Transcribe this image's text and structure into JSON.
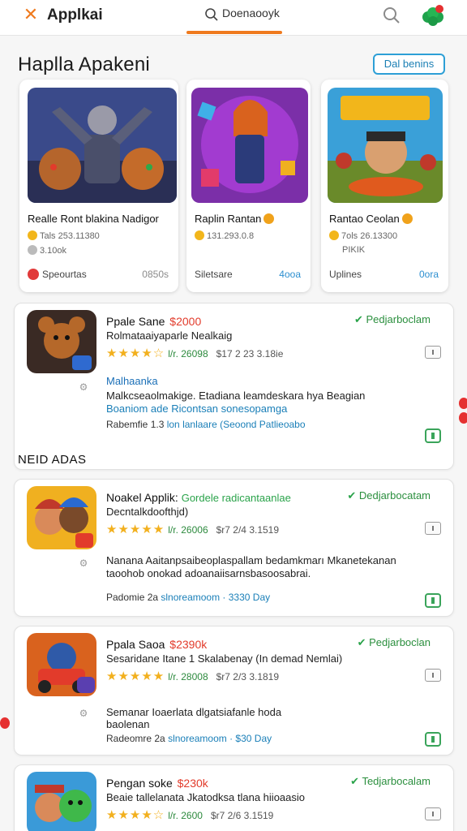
{
  "app": {
    "name": "Applkai",
    "search_value": "Doenaooyk",
    "accent": "#ef7a1e"
  },
  "section": {
    "title": "Haplla Apakeni",
    "button": "Dal benins"
  },
  "featured": [
    {
      "title": "Realle Ront blakina Nadigor",
      "meta1": "Tals 253.11380",
      "meta2": "3.10ok",
      "foot_left": "Speourtas",
      "foot_right": "0850s",
      "foot_right_color": "#8b8b8b"
    },
    {
      "title": "Raplin Rantan",
      "meta1": "131.293.0.8",
      "meta2": "",
      "foot_left": "Siletsare",
      "foot_right": "4ooa",
      "foot_right_color": "#2d8fd0"
    },
    {
      "title": "Rantao Ceolan",
      "meta1": "7ols 26.13300",
      "meta2": "PIKIK",
      "foot_left": "Uplines",
      "foot_right": "0ora",
      "foot_right_color": "#2d8fd0"
    }
  ],
  "section2": "NEID ADAS",
  "cards": [
    {
      "title": "Ppale Sane",
      "price": "$2000",
      "tag": "",
      "status": "Pedjarboclam",
      "subtitle": "Rolmataaiyaparle Nealkaig",
      "rating": "★★★★☆",
      "version": "l/r. 26098",
      "size": "$17 2 23 3.18ie",
      "category": "Malhaanka",
      "desc1": "Malkcseaolmakige. Etadiana leamdeskara hya Beagian",
      "desc2": "Boaniom ade Ricontsan sonesopamga",
      "foot_a": "Rabemfie 1.3",
      "foot_b": "lon lanlaare (Seoond Patlieoabo"
    },
    {
      "title": "Noakel Applik:",
      "price": "",
      "tag": "Gordele radicantaanlae",
      "status": "Dedjarbocatam",
      "subtitle": "Decntalkdoofthjd)",
      "rating": "★★★★★",
      "version": "l/r. 26006",
      "size": "$r7 2/4 3.1519",
      "category": "",
      "desc1": "Nanana Aaitanpsaibeoplaspallam bedamkmarı Mkanetekanan",
      "desc2": "taoohob onokad adoanaiisarnsbasoosabrai.",
      "foot_a": "Padomie 2a",
      "foot_b": "slnoreamoom · 3330 Day"
    },
    {
      "title": "Ppala Saoa",
      "price": "$2390k",
      "tag": "",
      "status": "Pedjarboclan",
      "subtitle": "Sesaridane Itane 1 Skalabenay (In demad Nemlai)",
      "rating": "★★★★★",
      "version": "l/r. 28008",
      "size": "$r7 2/3 3.1819",
      "category": "",
      "desc1": "Semanar Ioaerlata dlgatsiafanle hoda",
      "desc2": "baolenan",
      "foot_a": "Radeomre 2a",
      "foot_b": "slnoreamoom · $30 Day"
    },
    {
      "title": "Pengan soke",
      "price": "$230k",
      "tag": "",
      "status": "Tedjarbocalam",
      "subtitle": "Beaie tallelanata Jkatodksa tlana hiioaasio",
      "rating": "★★★★☆",
      "version": "l/r. 2600",
      "size": "$r7 2/6 3.1519"
    }
  ]
}
